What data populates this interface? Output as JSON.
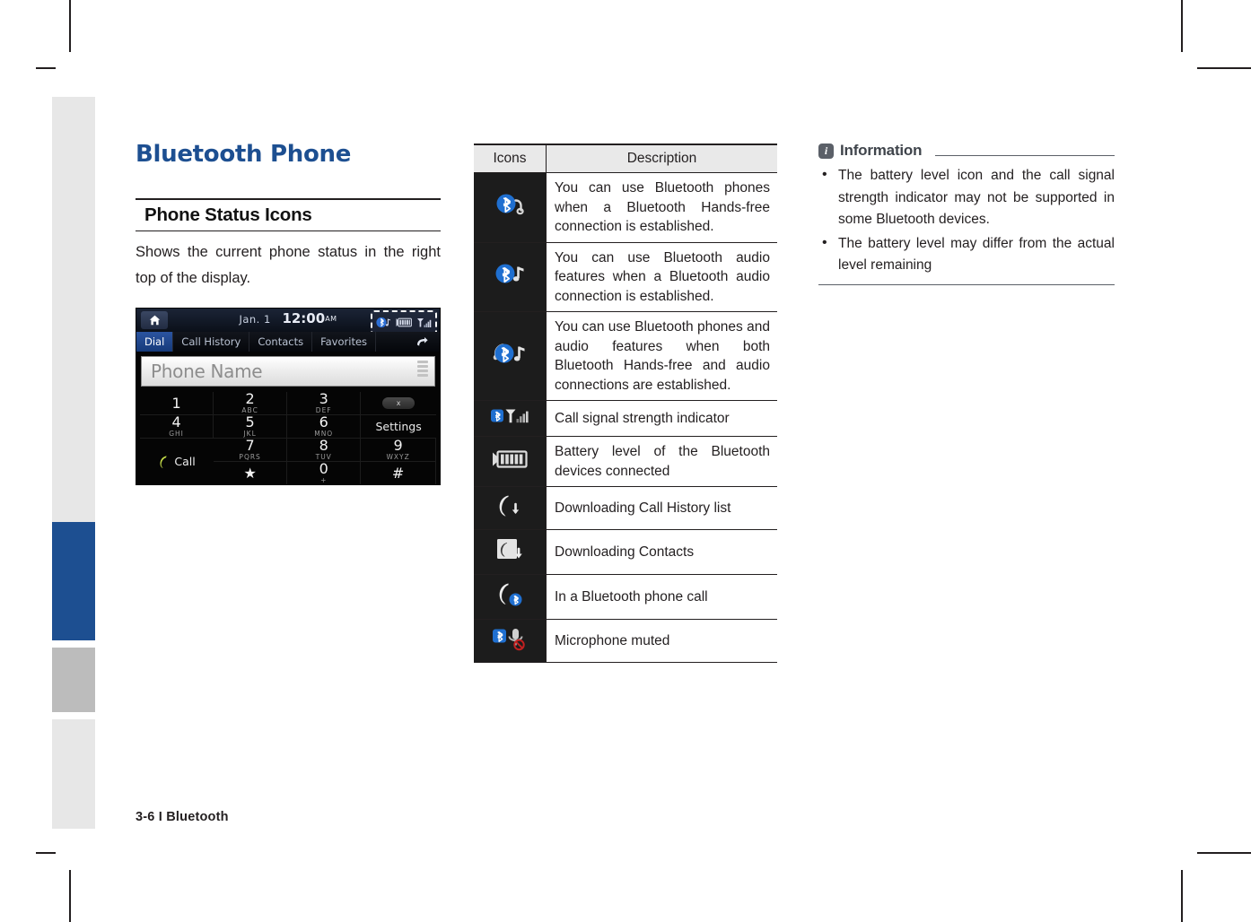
{
  "page": {
    "footer": "3-6 I Bluetooth",
    "accent_blue": "#1d4f91",
    "tab_gray": "#e7e7e7",
    "tab_mid_gray": "#bcbcbc"
  },
  "left": {
    "title": "Bluetooth Phone",
    "section_heading": "Phone Status Icons",
    "intro": "Shows the current phone status in the right top of the display."
  },
  "headunit": {
    "home_icon": "home-icon",
    "date": "Jan.  1",
    "time": "12:00",
    "ampm": "AM",
    "status_icons": [
      "bluetooth-audio-icon",
      "battery-icon",
      "signal-icon"
    ],
    "tabs": [
      {
        "label": "Dial",
        "active": true
      },
      {
        "label": "Call History",
        "active": false
      },
      {
        "label": "Contacts",
        "active": false
      },
      {
        "label": "Favorites",
        "active": false
      }
    ],
    "back_icon": "back-arrow-icon",
    "input_placeholder": "Phone Name",
    "keys": [
      {
        "num": "1",
        "sub": ""
      },
      {
        "num": "2",
        "sub": "ABC"
      },
      {
        "num": "3",
        "sub": "DEF"
      },
      {
        "num": "4",
        "sub": "GHI"
      },
      {
        "num": "5",
        "sub": "JKL"
      },
      {
        "num": "6",
        "sub": "MNO"
      },
      {
        "num": "7",
        "sub": "PQRS"
      },
      {
        "num": "8",
        "sub": "TUV"
      },
      {
        "num": "9",
        "sub": "WXYZ"
      },
      {
        "num": "★",
        "sub": ""
      },
      {
        "num": "0",
        "sub": "+"
      },
      {
        "num": "#",
        "sub": ""
      }
    ],
    "delete_label": "x",
    "settings_label": "Settings",
    "call_label": "Call"
  },
  "table": {
    "headers": {
      "icons": "Icons",
      "description": "Description"
    },
    "rows": [
      {
        "icon": "bluetooth-handsfree-icon",
        "description": "You can use Bluetooth phones when a Bluetooth Hands-free connection is established."
      },
      {
        "icon": "bluetooth-audio-icon",
        "description": "You can use Bluetooth audio features when a Bluetooth audio connection is established."
      },
      {
        "icon": "bluetooth-handsfree-audio-icon",
        "description": "You can use Bluetooth phones and audio features when both Bluetooth Hands-free and audio connections are established."
      },
      {
        "icon": "bluetooth-signal-strength-icon",
        "description": "Call signal strength indicator"
      },
      {
        "icon": "battery-level-icon",
        "description": "Battery level of the Bluetooth devices connected"
      },
      {
        "icon": "download-call-history-icon",
        "description": "Downloading Call History list"
      },
      {
        "icon": "download-contacts-icon",
        "description": "Downloading Contacts"
      },
      {
        "icon": "in-bluetooth-call-icon",
        "description": "In a Bluetooth phone call"
      },
      {
        "icon": "microphone-muted-icon",
        "description": "Microphone muted"
      }
    ]
  },
  "information": {
    "badge": "i",
    "title": "Information",
    "bullets": [
      "The battery level icon and the call signal strength indicator may not be supported in some Bluetooth devices.",
      "The battery level may differ from the actual level remaining"
    ]
  }
}
